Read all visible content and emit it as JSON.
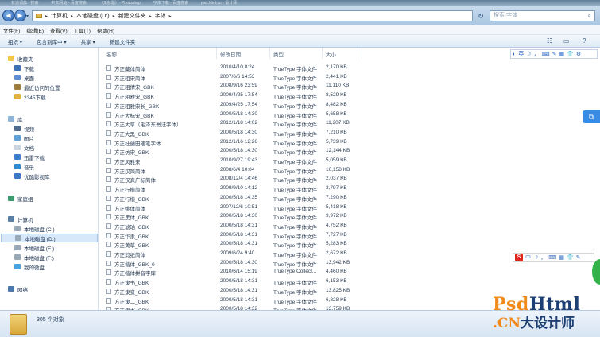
{
  "taskbar_tabs": [
    "有道词典 - 搜索",
    "中文网站 - 百度搜索",
    "（无标题）- Photoshop",
    "字体下载 - 百度搜索",
    "psd.html.cn - 设计师"
  ],
  "address": {
    "crumbs": [
      "计算机",
      "本地磁盘 (D:)",
      "新建文件夹",
      "字体"
    ],
    "search_placeholder": "搜索 字体"
  },
  "menu": [
    "文件(F)",
    "编辑(E)",
    "查看(V)",
    "工具(T)",
    "帮助(H)"
  ],
  "toolbar": [
    "组织 ▾",
    "包含到库中 ▾",
    "共享 ▾",
    "新建文件夹"
  ],
  "nav": {
    "favorites": "收藏夹",
    "fav_items": [
      "下载",
      "桌面",
      "最近访问的位置",
      "2345下载"
    ],
    "libraries": "库",
    "lib_items": [
      "视频",
      "图片",
      "文档",
      "迅雷下载",
      "音乐",
      "优酷影视库"
    ],
    "homegroup": "家庭组",
    "computer": "计算机",
    "drives": [
      "本地磁盘 (C:)",
      "本地磁盘 (D:)",
      "本地磁盘 (E:)",
      "本地磁盘 (F:)",
      "我的微盘"
    ],
    "network": "网络"
  },
  "columns": {
    "name": "名称",
    "date": "修改日期",
    "type": "类型",
    "size": "大小"
  },
  "files": [
    [
      "方正藏体简体",
      "2010/4/10 8:24",
      "TrueType 字体文件",
      "2,170 KB"
    ],
    [
      "方正粗宋简体",
      "2007/6/6 14:53",
      "TrueType 字体文件",
      "2,441 KB"
    ],
    [
      "方正粗倩宋_GBK",
      "2008/9/16 23:59",
      "TrueType 字体文件",
      "11,110 KB"
    ],
    [
      "方正粗雅宋_GBK",
      "2009/4/25 17:54",
      "TrueType 字体文件",
      "8,529 KB"
    ],
    [
      "方正粗雅宋长_GBK",
      "2009/4/25 17:54",
      "TrueType 字体文件",
      "8,482 KB"
    ],
    [
      "方正大标宋_GBK",
      "2000/5/18 14:30",
      "TrueType 字体文件",
      "5,658 KB"
    ],
    [
      "方正大草（毛泽东书法字体）",
      "2012/1/18 14:02",
      "TrueType 字体文件",
      "11,207 KB"
    ],
    [
      "方正大黑_GBK",
      "2000/5/18 14:30",
      "TrueType 字体文件",
      "7,210 KB"
    ],
    [
      "方正杜蘭田硬笔字体",
      "2012/1/16 12:26",
      "TrueType 字体文件",
      "5,739 KB"
    ],
    [
      "方正仿宋_GBK",
      "2000/5/18 14:30",
      "TrueType 字体文件",
      "12,144 KB"
    ],
    [
      "方正风雅宋",
      "2010/9/27 19:43",
      "TrueType 字体文件",
      "5,059 KB"
    ],
    [
      "方正汉简简体",
      "2008/6/4 10:04",
      "TrueType 字体文件",
      "10,158 KB"
    ],
    [
      "方正汉真广标简体",
      "2008/12/4 14:46",
      "TrueType 字体文件",
      "2,037 KB"
    ],
    [
      "方正行楷简体",
      "2009/9/10 14:12",
      "TrueType 字体文件",
      "3,797 KB"
    ],
    [
      "方正行楷_GBK",
      "2000/5/18 14:35",
      "TrueType 字体文件",
      "7,290 KB"
    ],
    [
      "方正姚体简体",
      "2007/12/6 10:51",
      "TrueType 字体文件",
      "5,418 KB"
    ],
    [
      "方正黑体_GBK",
      "2000/5/18 14:30",
      "TrueType 字体文件",
      "9,972 KB"
    ],
    [
      "方正琥珀_GBK",
      "2000/5/18 14:31",
      "TrueType 字体文件",
      "4,752 KB"
    ],
    [
      "方正华隶_GBK",
      "2000/5/18 14:31",
      "TrueType 字体文件",
      "7,727 KB"
    ],
    [
      "方正黄草_GBK",
      "2000/5/18 14:31",
      "TrueType 字体文件",
      "5,283 KB"
    ],
    [
      "方正剪纸简体",
      "2009/6/24 9:40",
      "TrueType 字体文件",
      "2,672 KB"
    ],
    [
      "方正楷体_GBK_0",
      "2000/5/18 14:30",
      "TrueType 字体文件",
      "13,942 KB"
    ],
    [
      "方正楷体拼音字库",
      "2010/6/14 15:19",
      "TrueType Collect...",
      "4,460 KB"
    ],
    [
      "方正隶书_GBK",
      "2000/5/18 14:31",
      "TrueType 字体文件",
      "6,153 KB"
    ],
    [
      "方正隶变_GBK",
      "2000/5/18 14:31",
      "TrueType 字体文件",
      "13,825 KB"
    ],
    [
      "方正隶二_GBK",
      "2000/5/18 14:31",
      "TrueType 字体文件",
      "6,828 KB"
    ],
    [
      "方正隶书_GBK",
      "2000/5/18 14:32",
      "TrueType 字体文件",
      "13,759 KB"
    ]
  ],
  "status": {
    "count": "305 个对象"
  },
  "ime_top": [
    "英",
    "☽",
    "，",
    "⌨",
    "✎",
    "▦",
    "👕",
    "⚙"
  ],
  "ime_bottom": [
    "S",
    "中",
    "☽",
    "，",
    "⌨",
    "▦",
    "👕",
    "✎"
  ],
  "watermark": {
    "line1_a": "Psd",
    "line1_b": "Html",
    "line2_a": ".CN",
    "line2_b": "大设计师"
  }
}
